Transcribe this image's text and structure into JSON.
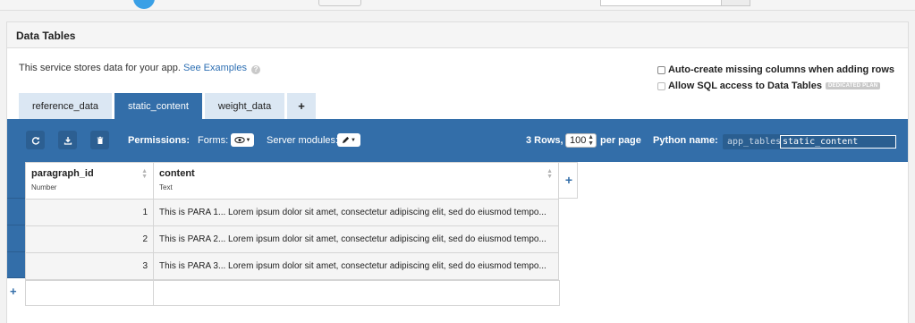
{
  "panel": {
    "title": "Data Tables",
    "description": "This service stores data for your app.",
    "examples_link": "See Examples",
    "help_icon": "?"
  },
  "options": {
    "auto_create": {
      "label": "Auto-create missing columns when adding rows",
      "checked": false
    },
    "sql_access": {
      "label": "Allow SQL access to Data Tables",
      "checked": false,
      "badge": "DEDICATED PLAN"
    }
  },
  "tabs": [
    {
      "label": "reference_data",
      "active": false
    },
    {
      "label": "static_content",
      "active": true
    },
    {
      "label": "weight_data",
      "active": false
    },
    {
      "label": "+",
      "active": false
    }
  ],
  "toolbar": {
    "refresh_icon": "refresh-icon",
    "download_icon": "download-icon",
    "delete_icon": "trash-icon",
    "permissions_label": "Permissions:",
    "forms_label": "Forms:",
    "forms_value_icon": "eye-icon",
    "server_modules_label": "Server modules:",
    "server_modules_value_icon": "pencil-icon",
    "rows_count": "3 Rows,",
    "per_page_value": "100",
    "per_page_label": "per page",
    "python_name_label": "Python name:",
    "python_prefix": "app_tables.",
    "python_name_value": "static_content"
  },
  "table": {
    "columns": [
      {
        "name": "paragraph_id",
        "type": "Number"
      },
      {
        "name": "content",
        "type": "Text"
      }
    ],
    "rows": [
      {
        "paragraph_id": "1",
        "content": "This is PARA 1... Lorem ipsum dolor sit amet, consectetur adipiscing elit, sed do eiusmod tempo..."
      },
      {
        "paragraph_id": "2",
        "content": "This is PARA 2... Lorem ipsum dolor sit amet, consectetur adipiscing elit, sed do eiusmod tempo..."
      },
      {
        "paragraph_id": "3",
        "content": "This is PARA 3... Lorem ipsum dolor sit amet, consectetur adipiscing elit, sed do eiusmod tempo..."
      }
    ],
    "add_column": "+",
    "add_row": "+"
  },
  "colors": {
    "accent": "#336ea9",
    "tab_inactive": "#dbe7f3",
    "link": "#2d6fb3"
  }
}
